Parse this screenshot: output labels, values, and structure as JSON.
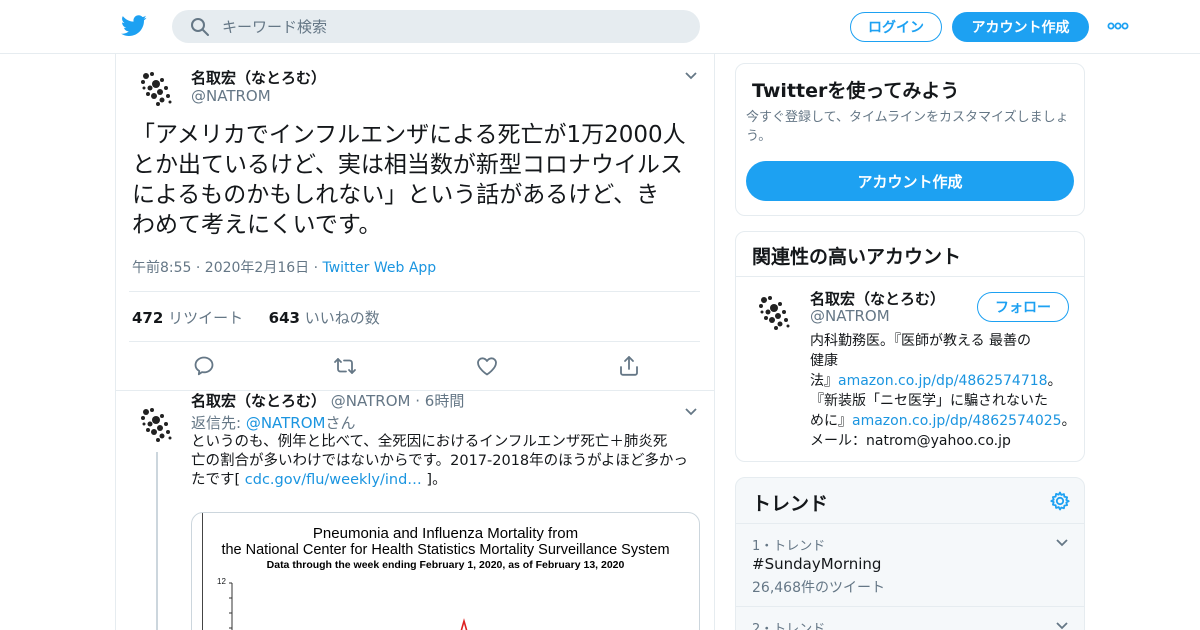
{
  "colors": {
    "accent": "#1da1f2",
    "link": "#1b95e0",
    "muted": "#657786"
  },
  "nav": {
    "logo_icon": "twitter-bird-icon",
    "search_placeholder": "キーワード検索",
    "login_label": "ログイン",
    "signup_label": "アカウント作成",
    "more_icon": "more-dots-icon"
  },
  "main_tweet": {
    "author_name": "名取宏（なとろむ）",
    "author_handle": "@NATROM",
    "text_lines": [
      "「アメリカでインフルエンザによる死亡が1万2000人",
      "とか出ているけど、実は相当数が新型コロナウイルス",
      "によるものかもしれない」という話があるけど、き",
      "わめて考えにくいです。"
    ],
    "time": "午前8:55 · 2020年2月16日 · ",
    "via": "Twitter Web App",
    "retweets_count": "472",
    "retweets_label": "リツイート",
    "likes_count": "643",
    "likes_label": "いいねの数"
  },
  "reply_tweet": {
    "author_name": "名取宏（なとろむ）",
    "author_handle": "@NATROM",
    "time": "· 6時間",
    "reply_prefix": "返信先: ",
    "reply_to": "@NATROM",
    "reply_suffix": "さん",
    "text_line1": "というのも、例年と比べて、全死因におけるインフルエンザ死亡＋肺炎死",
    "text_line2": "亡の割合が多いわけではないからです。2017-2018年のほうがよほど多かっ",
    "text_line3_a": "たです[ ",
    "text_line3_link": "cdc.gov/flu/weekly/ind…",
    "text_line3_b": " ]。",
    "image": {
      "title_line1": "Pneumonia and Influenza Mortality from",
      "title_line2": "the National Center for Health Statistics Mortality Surveillance System",
      "subtitle": "Data through the week ending February 1, 2020, as of February 13, 2020",
      "y_tick_top": "12"
    }
  },
  "signup_panel": {
    "title": "Twitterを使ってみよう",
    "desc_line1": "今すぐ登録して、タイムラインをカスタマイズしましょ",
    "desc_line2": "う。",
    "button": "アカウント作成"
  },
  "related_panel": {
    "title": "関連性の高いアカウント",
    "name": "名取宏（なとろむ）",
    "handle": "@NATROM",
    "follow": "フォロー",
    "bio_line1": "内科勤務医。『医師が教える 最善の",
    "bio_line2": "健康",
    "bio_line3_a": "法』",
    "bio_line3_link": "amazon.co.jp/dp/4862574718",
    "bio_line3_b": "。",
    "bio_line4": "『新装版「ニセ医学」に騙されないた",
    "bio_line5_a": "めに』",
    "bio_line5_link": "amazon.co.jp/dp/4862574025",
    "bio_line5_b": "。",
    "bio_line6": "メール：natrom@yahoo.co.jp"
  },
  "trends_panel": {
    "title": "トレンド",
    "items": [
      {
        "rank": "1・トレンド",
        "name": "#SundayMorning",
        "count": "26,468件のツイート"
      },
      {
        "rank": "2・トレンド"
      }
    ]
  }
}
